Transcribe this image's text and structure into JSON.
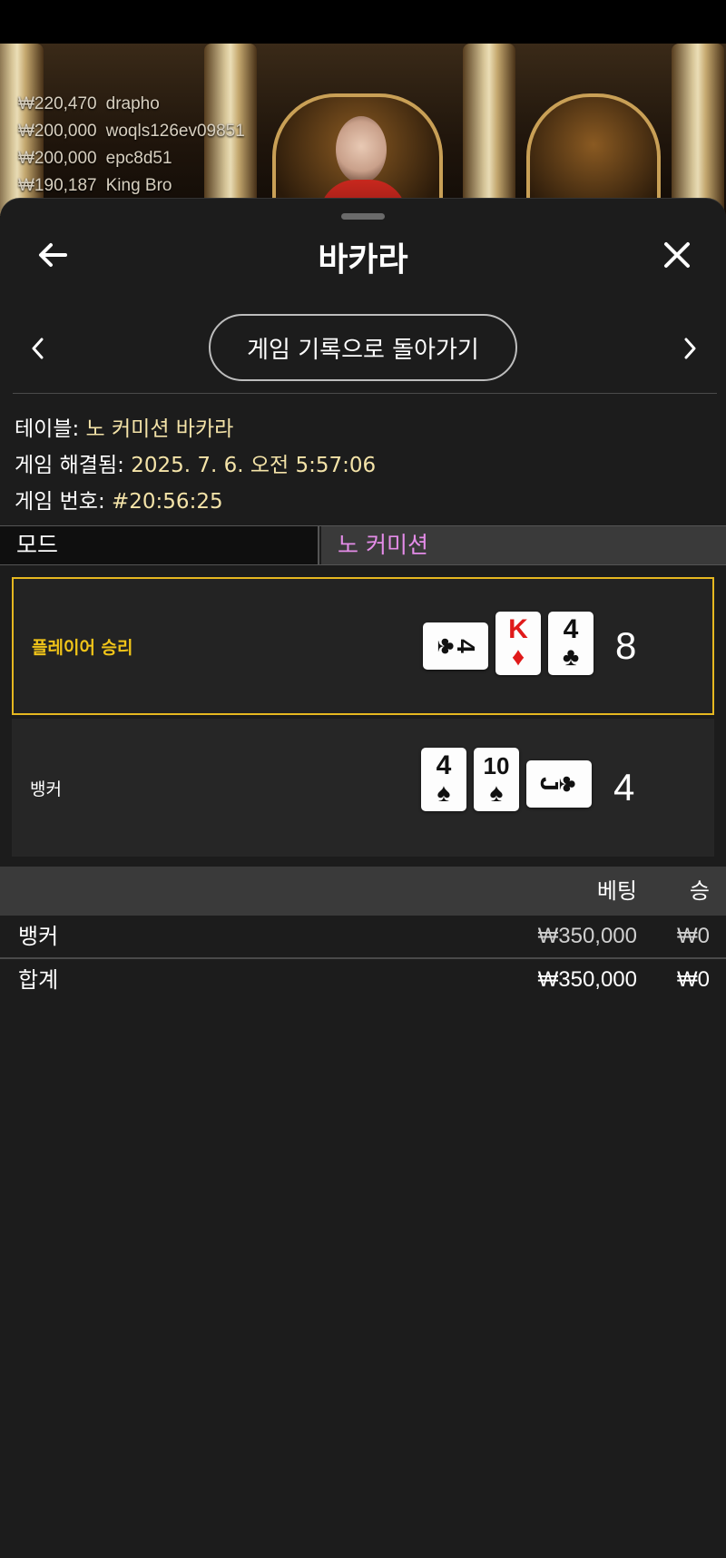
{
  "top_winners": [
    {
      "amount": "₩220,470",
      "name": "drapho"
    },
    {
      "amount": "₩200,000",
      "name": "woqls126ev09851"
    },
    {
      "amount": "₩200,000",
      "name": "epc8d51"
    },
    {
      "amount": "₩190,187",
      "name": "King Bro"
    }
  ],
  "sheet": {
    "title": "바카라",
    "back_to_history": "게임 기록으로 돌아가기"
  },
  "details": {
    "table_label": "테이블:",
    "table_value": "노 커미션 바카라",
    "settled_label": "게임 해결됨:",
    "settled_value": "2025. 7. 6. 오전 5:57:06",
    "game_no_label": "게임 번호:",
    "game_no_value": "#20:56:25"
  },
  "mode": {
    "label": "모드",
    "value": "노 커미션"
  },
  "hands": {
    "player": {
      "label": "플레이어 승리",
      "score": "8",
      "cards": [
        {
          "rank": "4",
          "suit": "♣",
          "orientation": "horizontal"
        },
        {
          "rank": "K",
          "suit": "♦",
          "orientation": "vertical",
          "color": "#e01a1a"
        },
        {
          "rank": "4",
          "suit": "♣",
          "orientation": "vertical"
        }
      ]
    },
    "banker": {
      "label": "뱅커",
      "score": "4",
      "cards": [
        {
          "rank": "4",
          "suit": "♠",
          "orientation": "vertical"
        },
        {
          "rank": "10",
          "suit": "♠",
          "orientation": "vertical"
        },
        {
          "rank": "J",
          "suit": "♣",
          "orientation": "horizontal"
        }
      ]
    }
  },
  "bets": {
    "header_bet": "베팅",
    "header_win": "승",
    "rows": [
      {
        "name": "뱅커",
        "amount": "₩350,000",
        "win": "₩0"
      }
    ],
    "total": {
      "name": "합계",
      "amount": "₩350,000",
      "win": "₩0"
    }
  },
  "colors": {
    "accent_gold": "#e6b820",
    "mode_value": "#e48ce8",
    "info_value": "#f4e3a8"
  }
}
